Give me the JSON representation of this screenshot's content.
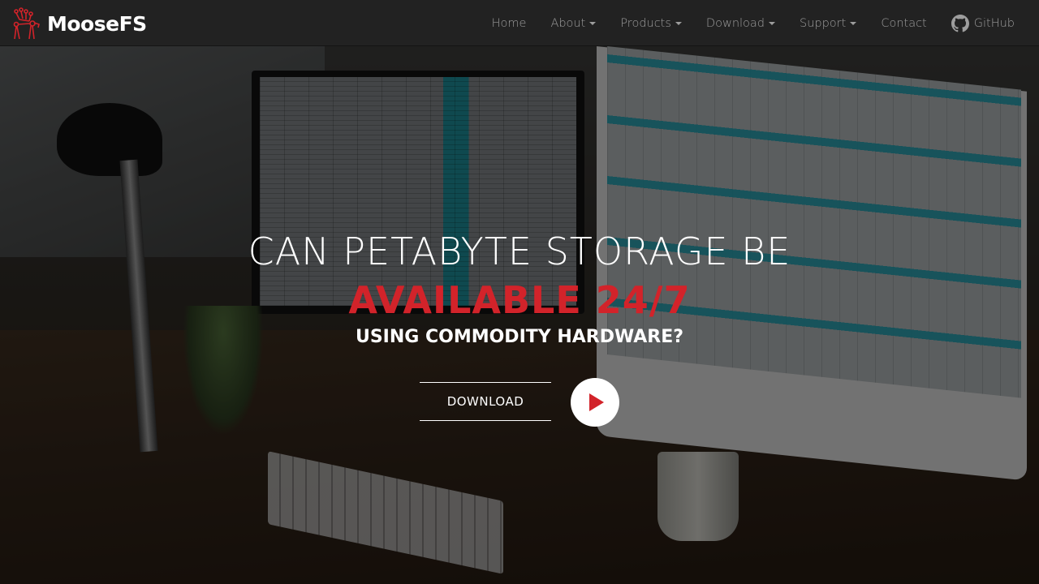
{
  "brand": {
    "name": "MooseFS",
    "logo_icon": "moose-antler-icon",
    "accent": "#d2232a"
  },
  "nav": {
    "items": [
      {
        "label": "Home",
        "dropdown": false
      },
      {
        "label": "About",
        "dropdown": true
      },
      {
        "label": "Products",
        "dropdown": true
      },
      {
        "label": "Download",
        "dropdown": true
      },
      {
        "label": "Support",
        "dropdown": true
      },
      {
        "label": "Contact",
        "dropdown": false
      }
    ],
    "github": {
      "label": "GitHub",
      "icon": "github-icon"
    }
  },
  "hero": {
    "line1": "CAN PETABYTE STORAGE BE",
    "line2": "AVAILABLE 24/7",
    "line3": "USING COMMODITY HARDWARE?",
    "download_label": "DOWNLOAD",
    "play_icon": "play-icon",
    "highlight_color": "#d2232a"
  }
}
